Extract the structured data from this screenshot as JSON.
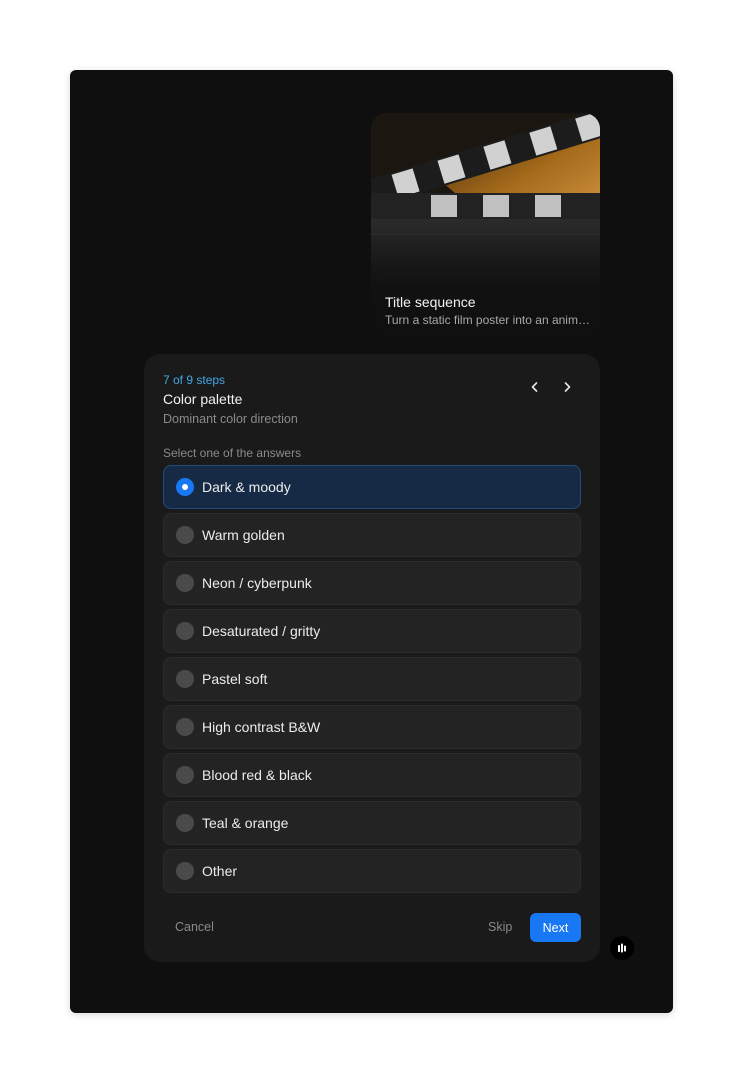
{
  "media_card": {
    "title": "Title sequence",
    "subtitle": "Turn a static film poster into an animated title sequence"
  },
  "question": {
    "step_label": "7 of 9 steps",
    "title": "Color palette",
    "subtitle": "Dominant color direction",
    "instruction": "Select one of the answers",
    "selected_index": 0,
    "options": [
      {
        "label": "Dark & moody"
      },
      {
        "label": "Warm golden"
      },
      {
        "label": "Neon / cyberpunk"
      },
      {
        "label": "Desaturated / gritty"
      },
      {
        "label": "Pastel soft"
      },
      {
        "label": "High contrast B&W"
      },
      {
        "label": "Blood red & black"
      },
      {
        "label": "Teal & orange"
      },
      {
        "label": "Other"
      }
    ]
  },
  "footer": {
    "cancel_label": "Cancel",
    "skip_label": "Skip",
    "next_label": "Next"
  },
  "icons": {
    "prev": "chevron-left-icon",
    "next": "chevron-right-icon",
    "fab": "audio-bars-icon"
  },
  "colors": {
    "accent": "#1877f2",
    "step_label": "#3fa8e6",
    "selected_bg": "#172a45",
    "frame_bg": "#0f0f0f",
    "panel_bg": "#1a1a1a"
  }
}
